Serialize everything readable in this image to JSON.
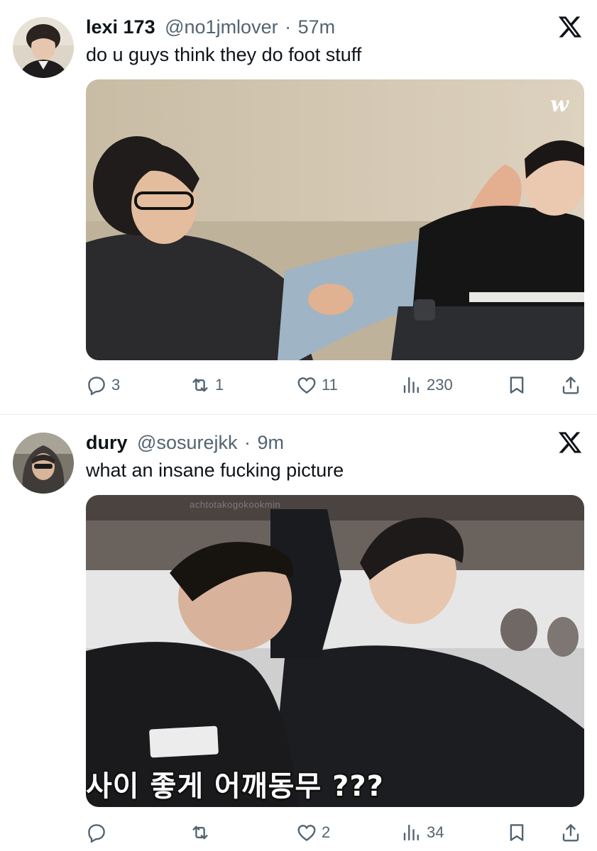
{
  "tweets": [
    {
      "name": "lexi 173",
      "handle": "@no1jmlover",
      "separator": "·",
      "time": "57m",
      "text": "do u guys think they do foot stuff",
      "media": {
        "overlay_logo": "w"
      },
      "stats": {
        "replies": "3",
        "retweets": "1",
        "likes": "11",
        "views": "230"
      }
    },
    {
      "name": "dury",
      "handle": "@sosurejkk",
      "separator": "·",
      "time": "9m",
      "text": "what an insane fucking picture",
      "media": {
        "watermark": "achtotakogokookmin",
        "caption": "사이 좋게 어깨동무 ???"
      },
      "stats": {
        "replies": "",
        "retweets": "",
        "likes": "2",
        "views": "34"
      }
    }
  ],
  "icons": {
    "platform": "x-logo-icon",
    "reply": "reply-icon",
    "retweet": "retweet-icon",
    "like": "heart-icon",
    "views": "views-icon",
    "bookmark": "bookmark-icon",
    "share": "share-icon"
  },
  "colors": {
    "text": "#0f1419",
    "secondary": "#536471",
    "divider": "#e6e9eb"
  }
}
